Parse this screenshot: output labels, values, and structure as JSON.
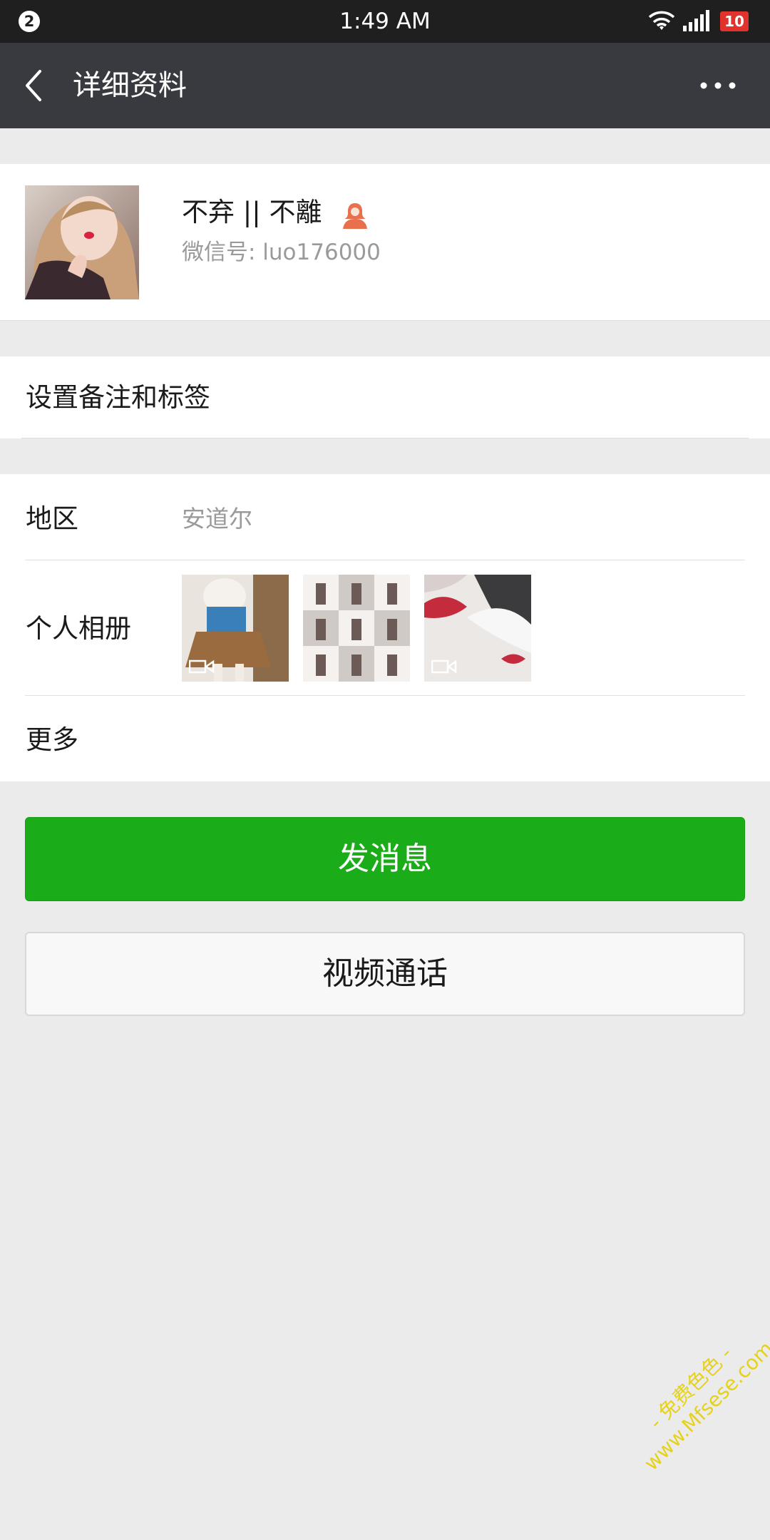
{
  "status_bar": {
    "notification_count": "2",
    "time": "1:49 AM",
    "battery_level": "10",
    "icons": [
      "wifi-icon",
      "signal-icon",
      "battery-icon"
    ]
  },
  "header": {
    "title": "详细资料",
    "back_icon": "back-arrow-icon",
    "more_icon": "more-dots-icon"
  },
  "profile": {
    "name": "不弃 || 不離",
    "gender_icon": "female-icon",
    "wechat_id": "微信号: luo176000"
  },
  "remark": {
    "label": "设置备注和标签"
  },
  "info": {
    "region_label": "地区",
    "region_value": "安道尔",
    "album_label": "个人相册",
    "album_thumbs": [
      "video",
      "image",
      "video"
    ],
    "more_label": "更多"
  },
  "actions": {
    "send_message": "发消息",
    "video_call": "视频通话"
  },
  "watermark": {
    "line1": "- 免费色色 -",
    "line2": "www.Mfsese.com"
  },
  "colors": {
    "header_bg": "#393a3f",
    "status_bg": "#1f1f1f",
    "primary_green": "#1aad19",
    "battery_red": "#e2322c",
    "page_bg": "#ebebeb"
  }
}
